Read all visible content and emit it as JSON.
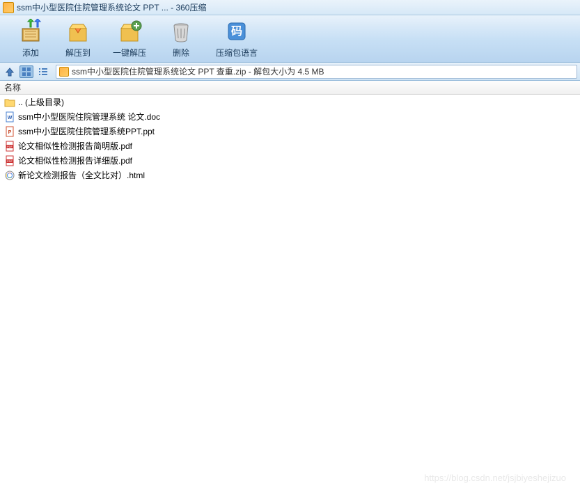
{
  "titlebar": {
    "text": "ssm中小型医院住院管理系统论文 PPT ... - 360压缩"
  },
  "toolbar": {
    "add_label": "添加",
    "extract_label": "解压到",
    "oneclick_label": "一键解压",
    "delete_label": "删除",
    "language_label": "压缩包语言"
  },
  "pathbar": {
    "text": "ssm中小型医院住院管理系统论文 PPT 查重.zip - 解包大小为 4.5 MB"
  },
  "columns": {
    "name": "名称"
  },
  "files": [
    {
      "name": ".. (上级目录)",
      "type": "folder"
    },
    {
      "name": "ssm中小型医院住院管理系统 论文.doc",
      "type": "doc"
    },
    {
      "name": "ssm中小型医院住院管理系统PPT.ppt",
      "type": "ppt"
    },
    {
      "name": "论文相似性检测报告简明版.pdf",
      "type": "pdf"
    },
    {
      "name": "论文相似性检测报告详细版.pdf",
      "type": "pdf"
    },
    {
      "name": "新论文检测报告（全文比对）.html",
      "type": "html"
    }
  ],
  "watermark": "https://blog.csdn.net/jsjbiyeshejizuo"
}
